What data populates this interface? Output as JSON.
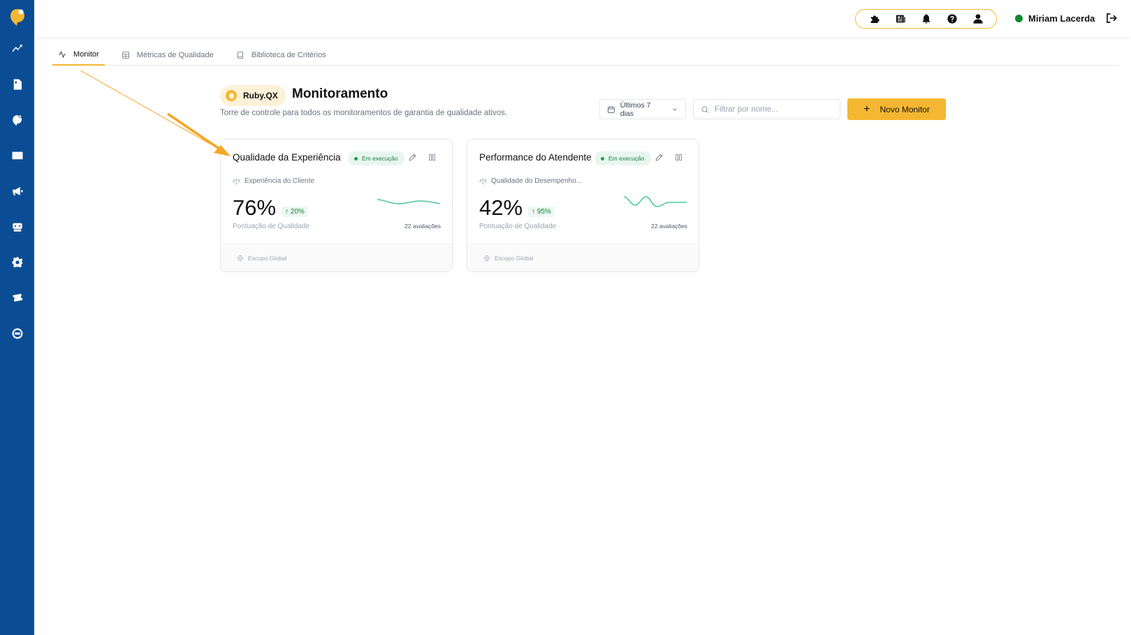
{
  "user": {
    "name": "Miriam Lacerda",
    "status_color": "#0e8a2d"
  },
  "colors": {
    "sidebar": "#0b4d94",
    "accent": "#f5b731",
    "success": "#16a34a"
  },
  "sidebar": {
    "items": [
      {
        "icon": "chart-line-icon"
      },
      {
        "icon": "document-icon"
      },
      {
        "icon": "brand-bubble-icon"
      },
      {
        "icon": "envelope-icon"
      },
      {
        "icon": "megaphone-icon"
      },
      {
        "icon": "robot-icon"
      },
      {
        "icon": "gear-icon"
      },
      {
        "icon": "ticket-icon"
      },
      {
        "icon": "nps-icon"
      }
    ]
  },
  "top_icons": [
    "puzzle-icon",
    "newspaper-icon",
    "bell-icon",
    "question-icon",
    "user-icon"
  ],
  "tabs": [
    {
      "label": "Monitor",
      "active": true,
      "icon": "activity-icon"
    },
    {
      "label": "Métricas de Qualidade",
      "active": false,
      "icon": "grid-icon"
    },
    {
      "label": "Biblioteca de Critérios",
      "active": false,
      "icon": "book-icon"
    }
  ],
  "header": {
    "brand": "Ruby.QX",
    "title": "Monitoramento",
    "subtitle": "Torre de controle para todos os monitoramentos de garantia de qualidade ativos."
  },
  "toolbar": {
    "date_range": "Últimos 7 dias",
    "search_placeholder": "Filtrar por nome...",
    "new_label": "Novo Monitor",
    "new_symbol": "+"
  },
  "cards": [
    {
      "title": "Qualidade da Experiência",
      "status": "Em execução",
      "category": "Experiência do Cliente",
      "score": "76%",
      "delta": "↑ 20%",
      "score_label": "Pontuação de Qualidade",
      "evaluations": "22 avaliações",
      "scope": "Escopo Global"
    },
    {
      "title": "Performance do Atendente",
      "status": "Em execução",
      "category": "Qualidade do Desempenho...",
      "score": "42%",
      "delta": "↑ 95%",
      "score_label": "Pontuação de Qualidade",
      "evaluations": "22 avaliações",
      "scope": "Escopo Global"
    }
  ]
}
